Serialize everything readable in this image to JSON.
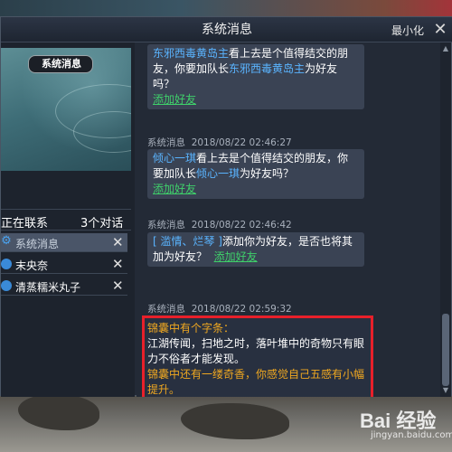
{
  "window": {
    "title": "系统消息",
    "minimize_label": "最小化",
    "close_symbol": "✕"
  },
  "sidebar": {
    "header_label": "系统消息",
    "contacts_label": "正在联系",
    "contacts_count": "3个对话",
    "items": [
      {
        "label": "系统消息",
        "icon": "gear-icon",
        "active": true
      },
      {
        "label": "末央奈",
        "icon": "chat-bubble-icon",
        "active": false
      },
      {
        "label": "清蒸糯米丸子",
        "icon": "chat-bubble-icon",
        "active": false
      }
    ],
    "close_symbol": "✕"
  },
  "messages": [
    {
      "name": "东邪西毒黄岛主",
      "text_before": "看上去是个值得结交的朋友，你要加队长",
      "name_repeat": "东邪西毒黄岛主",
      "text_after": "为好友吗？",
      "link": "添加好友"
    },
    {
      "sender": "系统消息",
      "time": "2018/08/22  02:46:27",
      "name": "倾心一琪",
      "text_before": "看上去是个值得结交的朋友，你要加队长",
      "name_repeat": "倾心一琪",
      "text_after": "为好友吗？",
      "link": "添加好友"
    },
    {
      "sender": "系统消息",
      "time": "2018/08/22  02:46:42",
      "name": "[ 滥情、烂琴 ]",
      "text_before": "添加你为好友，是否也将其加为好友？",
      "link": "添加好友"
    },
    {
      "sender": "系统消息",
      "time": "2018/08/22  02:59:32",
      "line1": "锦囊中有个字条：",
      "line2": "江湖传闻，扫地之时，落叶堆中的奇物只有眼力不俗者才能发现。",
      "line3": "锦囊中还有一缕奇香，你感觉自己五感有小幅提升。"
    }
  ],
  "colors": {
    "highlight_border": "#e8202a",
    "player_name": "#5ab4ff",
    "link": "#3fd06a",
    "note_orange": "#f0a820"
  },
  "watermark": {
    "brand": "Bai 经验",
    "sub": "jingyan.baidu.com"
  }
}
